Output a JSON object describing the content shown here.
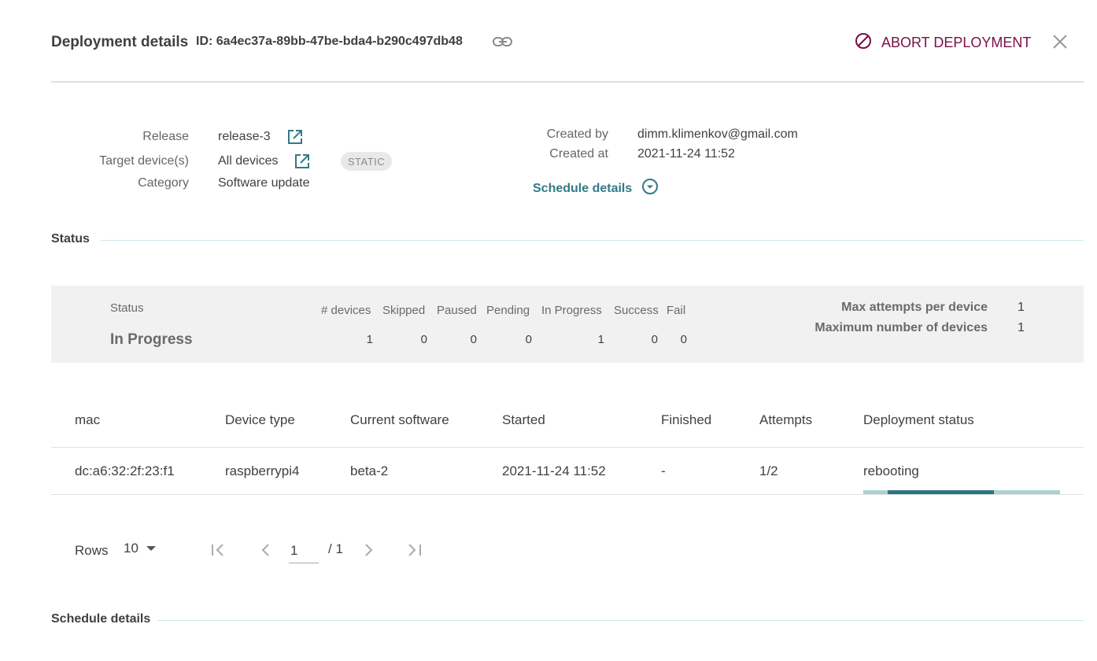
{
  "header": {
    "title": "Deployment details",
    "id_text": "ID: 6a4ec37a-89bb-47be-bda4-b290c497db48",
    "abort_label": "ABORT DEPLOYMENT"
  },
  "overview": {
    "release_label": "Release",
    "release_value": "release-3",
    "target_label": "Target device(s)",
    "target_value": "All devices",
    "target_chip": "STATIC",
    "category_label": "Category",
    "category_value": "Software update",
    "created_by_label": "Created by",
    "created_by_value": "dimm.klimenkov@gmail.com",
    "created_at_label": "Created at",
    "created_at_value": "2021-11-24 11:52",
    "schedule_toggle": "Schedule details"
  },
  "status_section": {
    "title": "Status",
    "status_label": "Status",
    "status_value": "In Progress",
    "counts": [
      {
        "label": "# devices",
        "value": "1"
      },
      {
        "label": "Skipped",
        "value": "0"
      },
      {
        "label": "Paused",
        "value": "0"
      },
      {
        "label": "Pending",
        "value": "0"
      },
      {
        "label": "In Progress",
        "value": "1"
      },
      {
        "label": "Success",
        "value": "0"
      },
      {
        "label": "Fail",
        "value": "0"
      }
    ],
    "max_attempts_label": "Max attempts per device",
    "max_attempts_value": "1",
    "max_devices_label": "Maximum number of devices",
    "max_devices_value": "1"
  },
  "table": {
    "columns": [
      "mac",
      "Device type",
      "Current software",
      "Started",
      "Finished",
      "Attempts",
      "Deployment status"
    ],
    "rows": [
      {
        "mac": "dc:a6:32:2f:23:f1",
        "device_type": "raspberrypi4",
        "software": "beta-2",
        "started": "2021-11-24 11:52",
        "finished": "-",
        "attempts": "1/2",
        "status": "rebooting"
      }
    ]
  },
  "pagination": {
    "rows_label": "Rows",
    "rows_value": "10",
    "page_value": "1",
    "page_total": "/ 1"
  },
  "schedule_section": {
    "title": "Schedule details"
  },
  "colors": {
    "accent": "#337a87",
    "abort": "#7a0f4a",
    "progress_track": "#aed0d5",
    "progress_fill": "#2c7584"
  }
}
